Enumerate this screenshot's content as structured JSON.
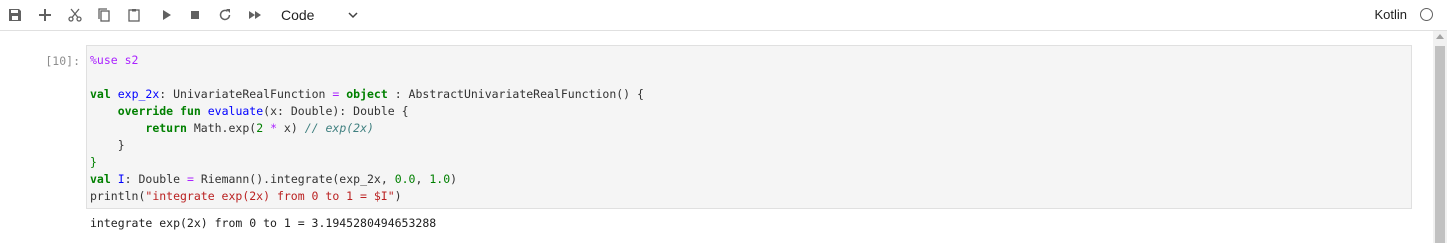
{
  "toolbar": {
    "buttons": [
      {
        "name": "save-icon"
      },
      {
        "name": "add-cell-icon"
      },
      {
        "name": "cut-icon"
      },
      {
        "name": "copy-icon"
      },
      {
        "name": "paste-icon"
      },
      {
        "name": "run-icon"
      },
      {
        "name": "stop-icon"
      },
      {
        "name": "restart-icon"
      },
      {
        "name": "run-all-icon"
      }
    ],
    "cell_type": "Code",
    "kernel_name": "Kotlin",
    "kernel_status": "idle"
  },
  "cell": {
    "prompt": "[10]:",
    "code": {
      "line1_magic": "%use s2",
      "line3_val": "val",
      "line3_name": "exp_2x",
      "line3_rest1": ": UnivariateRealFunction ",
      "line3_eq": "=",
      "line3_object": "object",
      "line3_rest2": " : AbstractUnivariateRealFunction() {",
      "line4_override": "override",
      "line4_fun": "fun",
      "line4_evaluate": "evaluate",
      "line4_rest": "(x: Double): Double {",
      "line5_return": "return",
      "line5_math": " Math.exp(",
      "line5_two": "2",
      "line5_star": "*",
      "line5_x": " x) ",
      "line5_comment": "// exp(2x)",
      "line6_close": "}",
      "line7_close": "}",
      "line8_val": "val",
      "line8_name": "I",
      "line8_rest1": ": Double ",
      "line8_eq": "=",
      "line8_rest2": " Riemann().integrate(exp_2x, ",
      "line8_n1": "0.0",
      "line8_comma": ", ",
      "line8_n2": "1.0",
      "line8_end": ")",
      "line9_println": "println(",
      "line9_str": "\"integrate exp(2x) from 0 to 1 = $I\"",
      "line9_end": ")"
    },
    "output": "integrate exp(2x) from 0 to 1 = 3.1945280494653288"
  },
  "colors": {
    "keyword": "#008000",
    "magic": "#aa22ff",
    "string": "#ba2121",
    "comment": "#408080",
    "function": "#0000ff"
  }
}
